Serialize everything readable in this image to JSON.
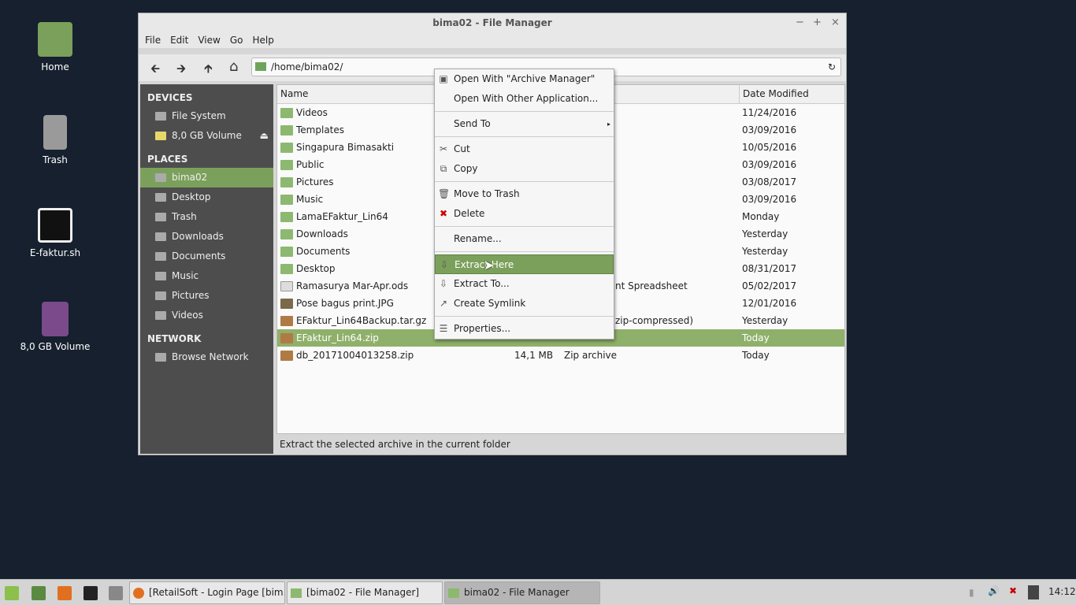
{
  "desktop": {
    "icons": [
      {
        "label": "Home"
      },
      {
        "label": "Trash"
      },
      {
        "label": "E-faktur.sh"
      },
      {
        "label": "8,0 GB Volume"
      }
    ]
  },
  "window": {
    "title": "bima02 - File Manager",
    "controls": [
      "−",
      "+",
      "×"
    ]
  },
  "menubar": [
    "File",
    "Edit",
    "View",
    "Go",
    "Help"
  ],
  "toolbar": {
    "back": "🡰",
    "forward": "🡲",
    "up": "🡱",
    "home": "⌂",
    "path": "/home/bima02/",
    "reload": "↻"
  },
  "sidebar": {
    "devices_title": "DEVICES",
    "devices": [
      {
        "label": "File System"
      },
      {
        "label": "8,0 GB Volume",
        "eject": "⏏"
      }
    ],
    "places_title": "PLACES",
    "places": [
      {
        "label": "bima02",
        "selected": true
      },
      {
        "label": "Desktop"
      },
      {
        "label": "Trash"
      },
      {
        "label": "Downloads"
      },
      {
        "label": "Documents"
      },
      {
        "label": "Music"
      },
      {
        "label": "Pictures"
      },
      {
        "label": "Videos"
      }
    ],
    "network_title": "NETWORK",
    "network": [
      {
        "label": "Browse Network"
      }
    ]
  },
  "columns": {
    "name": "Name",
    "date": "Date Modified"
  },
  "files": [
    {
      "name": "Videos",
      "size": "",
      "type": "",
      "date": "11/24/2016",
      "icon": "folder"
    },
    {
      "name": "Templates",
      "size": "",
      "type": "",
      "date": "03/09/2016",
      "icon": "folder"
    },
    {
      "name": "Singapura Bimasakti",
      "size": "",
      "type": "",
      "date": "10/05/2016",
      "icon": "folder"
    },
    {
      "name": "Public",
      "size": "",
      "type": "",
      "date": "03/09/2016",
      "icon": "folder"
    },
    {
      "name": "Pictures",
      "size": "",
      "type": "",
      "date": "03/08/2017",
      "icon": "folder"
    },
    {
      "name": "Music",
      "size": "",
      "type": "",
      "date": "03/09/2016",
      "icon": "folder"
    },
    {
      "name": "LamaEFaktur_Lin64",
      "size": "",
      "type": "",
      "date": "Monday",
      "icon": "folder"
    },
    {
      "name": "Downloads",
      "size": "",
      "type": "",
      "date": "Yesterday",
      "icon": "folder"
    },
    {
      "name": "Documents",
      "size": "",
      "type": "",
      "date": "Yesterday",
      "icon": "folder"
    },
    {
      "name": "Desktop",
      "size": "",
      "type": "",
      "date": "08/31/2017",
      "icon": "folder"
    },
    {
      "name": "Ramasurya Mar-Apr.ods",
      "size": "",
      "type": "nt Spreadsheet",
      "date": "05/02/2017",
      "icon": "doc"
    },
    {
      "name": "Pose bagus print.JPG",
      "size": "",
      "type": "",
      "date": "12/01/2016",
      "icon": "img"
    },
    {
      "name": "EFaktur_Lin64Backup.tar.gz",
      "size": "",
      "type": "zip-compressed)",
      "date": "Yesterday",
      "icon": "arc"
    },
    {
      "name": "EFaktur_Lin64.zip",
      "size": "",
      "type": "",
      "date": "Today",
      "icon": "arc",
      "selected": true
    },
    {
      "name": "db_20171004013258.zip",
      "size": "14,1 MB",
      "type": "Zip archive",
      "date": "Today",
      "icon": "arc"
    }
  ],
  "status": "Extract the selected archive in the current folder",
  "context_menu": [
    {
      "label": "Open With \"Archive Manager\"",
      "icon": "▣"
    },
    {
      "label": "Open With Other Application...",
      "icon": ""
    },
    {
      "sep": true
    },
    {
      "label": "Send To",
      "icon": "",
      "submenu": "▸"
    },
    {
      "sep": true
    },
    {
      "label": "Cut",
      "icon": "✂"
    },
    {
      "label": "Copy",
      "icon": "⧉"
    },
    {
      "sep": true
    },
    {
      "label": "Move to Trash",
      "icon": "🗑"
    },
    {
      "label": "Delete",
      "icon": "✖"
    },
    {
      "sep": true
    },
    {
      "label": "Rename...",
      "icon": ""
    },
    {
      "sep": true
    },
    {
      "label": "Extract Here",
      "icon": "⇩",
      "selected": true
    },
    {
      "label": "Extract To...",
      "icon": "⇩"
    },
    {
      "label": "Create Symlink",
      "icon": "↗"
    },
    {
      "sep": true
    },
    {
      "label": "Properties...",
      "icon": "☰"
    }
  ],
  "taskbar": {
    "buttons": [
      {
        "label": "[RetailSoft - Login Page [bim..."
      },
      {
        "label": "[bima02 - File Manager]"
      },
      {
        "label": "bima02 - File Manager",
        "active": true
      }
    ],
    "clock": "14:12"
  },
  "colors": {
    "accent": "#7ba05b",
    "desktop": "#16202e",
    "sidebar": "#4d4d4d"
  }
}
